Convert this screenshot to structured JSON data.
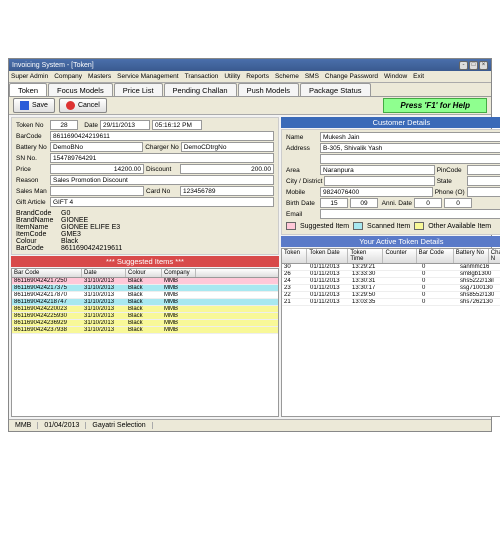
{
  "title": "Invoicing System - [Token]",
  "menu": [
    "Super Admin",
    "Company",
    "Masters",
    "Service Management",
    "Transaction",
    "Utility",
    "Reports",
    "Scheme",
    "SMS",
    "Change Password",
    "Window",
    "Exit"
  ],
  "tabs": [
    "Token",
    "Focus Models",
    "Price List",
    "Pending Challan",
    "Push Models",
    "Package Status"
  ],
  "toolbar": {
    "save": "Save",
    "cancel": "Cancel",
    "help": "Press 'F1' for Help"
  },
  "tok": {
    "tokenNo": "Token No",
    "tokenVal": "28",
    "date": "Date",
    "dateVal": "29/11/2013",
    "timeVal": "05:16:12 PM",
    "barcode": "BarCode",
    "barcodeVal": "8611690424219611",
    "batteryNo": "Battery No",
    "batteryVal": "DemoBNo",
    "chargerNo": "Charger No",
    "chargerVal": "DemoCDtrgNo",
    "snNo": "SN No.",
    "snVal": "154789764291",
    "price": "Price",
    "priceVal": "14200.00",
    "discount": "Discount",
    "discountVal": "200.00",
    "reason": "Reason",
    "reasonVal": "Sales Promotion Discount",
    "salesMan": "Sales Man",
    "cardNo": "Card No",
    "cardVal": "123456789",
    "giftArticle": "Gift Article",
    "giftVal": "GIFT 4"
  },
  "det": [
    [
      "BrandCode",
      "G0"
    ],
    [
      "BrandName",
      "GIONEE"
    ],
    [
      "ItemName",
      "GIONEE ELIFE E3"
    ],
    [
      "ItemCode",
      "GME3"
    ],
    [
      "Colour",
      "Black"
    ],
    [
      "BarCode",
      "8611690424219611"
    ]
  ],
  "cust": {
    "hd": "Customer Details",
    "name": "Name",
    "nameVal": "Mukesh Jain",
    "address": "Address",
    "addressVal": "B-305, Shivalik Yash",
    "area": "Area",
    "areaVal": "Naranpura",
    "pincode": "PinCode",
    "city": "City / District",
    "state": "State",
    "mobile": "Mobile",
    "mobileVal": "9824076400",
    "phone": "Phone (O)",
    "birthDate": "Birth Date",
    "bd": "15",
    "bm": "09",
    "anniDate": "Anni. Date",
    "ad": "0",
    "am": "0",
    "email": "Email"
  },
  "legend": [
    {
      "c": "#ffc8d8",
      "t": "Suggested Item"
    },
    {
      "c": "#a8e8f0",
      "t": "Scanned Item"
    },
    {
      "c": "#f8f898",
      "t": "Other Available Item"
    }
  ],
  "sugHd": "*** Suggested Items ***",
  "sugCols": [
    "Bar Code",
    "Date",
    "Colour",
    "Company"
  ],
  "sug": [
    {
      "r": [
        "8611690424217250",
        "31/10/2013",
        "Black",
        "MMB"
      ],
      "cl": "hl-pink"
    },
    {
      "r": [
        "8611690424217375",
        "31/10/2013",
        "Black",
        "MMB"
      ],
      "cl": "hl-cyan"
    },
    {
      "r": [
        "8611690424217870",
        "31/10/2013",
        "Black",
        "MMB"
      ],
      "cl": ""
    },
    {
      "r": [
        "8611690424218747",
        "31/10/2013",
        "Black",
        "MMB"
      ],
      "cl": "hl-cyan"
    },
    {
      "r": [
        "8611690424220023",
        "31/10/2013",
        "Black",
        "MMB"
      ],
      "cl": "hl-yellow"
    },
    {
      "r": [
        "8611690424225930",
        "31/10/2013",
        "Black",
        "MMB"
      ],
      "cl": "hl-yellow"
    },
    {
      "r": [
        "8611690424236929",
        "31/10/2013",
        "Black",
        "MMB"
      ],
      "cl": "hl-yellow"
    },
    {
      "r": [
        "8611690424237938",
        "31/10/2013",
        "Black",
        "MMB"
      ],
      "cl": "hl-yellow"
    }
  ],
  "actHd": "Your Active Token Details",
  "actCols": [
    "Token",
    "Token Date",
    "Token Time",
    "Counter",
    "Bar Code",
    "Battery No",
    "Charger N"
  ],
  "act": [
    [
      "30",
      "01/11/2013",
      "13:29:21",
      "",
      "0",
      "sanmmc16",
      ""
    ],
    [
      "26",
      "01/11/2013",
      "13:33:30",
      "",
      "0",
      "sm8gb1300",
      ""
    ],
    [
      "24",
      "01/11/2013",
      "13:30:31",
      "",
      "0",
      "shs5222/13il",
      ""
    ],
    [
      "23",
      "01/11/2013",
      "13:30:17",
      "",
      "0",
      "ssg7100130",
      ""
    ],
    [
      "22",
      "01/11/2013",
      "13:29:50",
      "",
      "0",
      "shs8552/130",
      ""
    ],
    [
      "21",
      "01/11/2013",
      "13:03:35",
      "",
      "0",
      "shs7262130",
      ""
    ]
  ],
  "status": [
    "MMB",
    "01/04/2013",
    "Gayatri Selection"
  ]
}
